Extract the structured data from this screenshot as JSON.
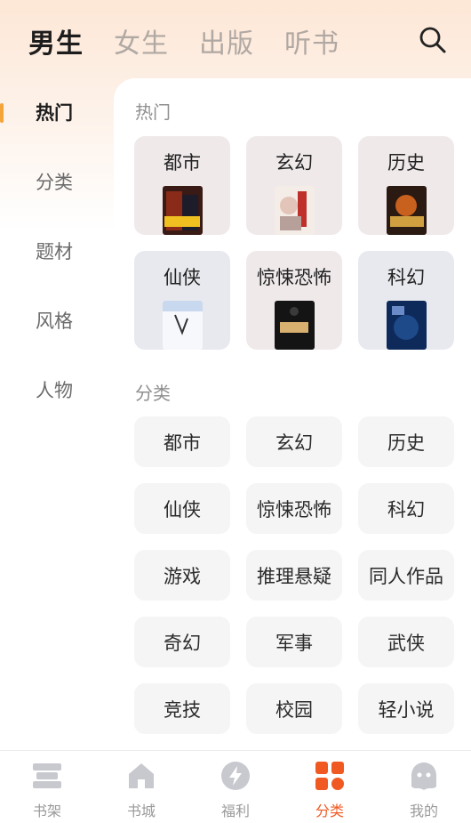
{
  "top_tabs": [
    "男生",
    "女生",
    "出版",
    "听书"
  ],
  "sidebar": [
    "热门",
    "分类",
    "题材",
    "风格",
    "人物"
  ],
  "hot": {
    "title": "热门",
    "items": [
      "都市",
      "玄幻",
      "历史",
      "仙侠",
      "惊悚恐怖",
      "科幻"
    ]
  },
  "category": {
    "title": "分类",
    "items": [
      "都市",
      "玄幻",
      "历史",
      "仙侠",
      "惊悚恐怖",
      "科幻",
      "游戏",
      "推理悬疑",
      "同人作品",
      "奇幻",
      "军事",
      "武侠",
      "竞技",
      "校园",
      "轻小说"
    ]
  },
  "bottom_nav": [
    "书架",
    "书城",
    "福利",
    "分类",
    "我的"
  ],
  "colors": {
    "accent": "#f05a22",
    "indicator": "#f4a53a",
    "nav_inactive": "#c7c9cf"
  }
}
